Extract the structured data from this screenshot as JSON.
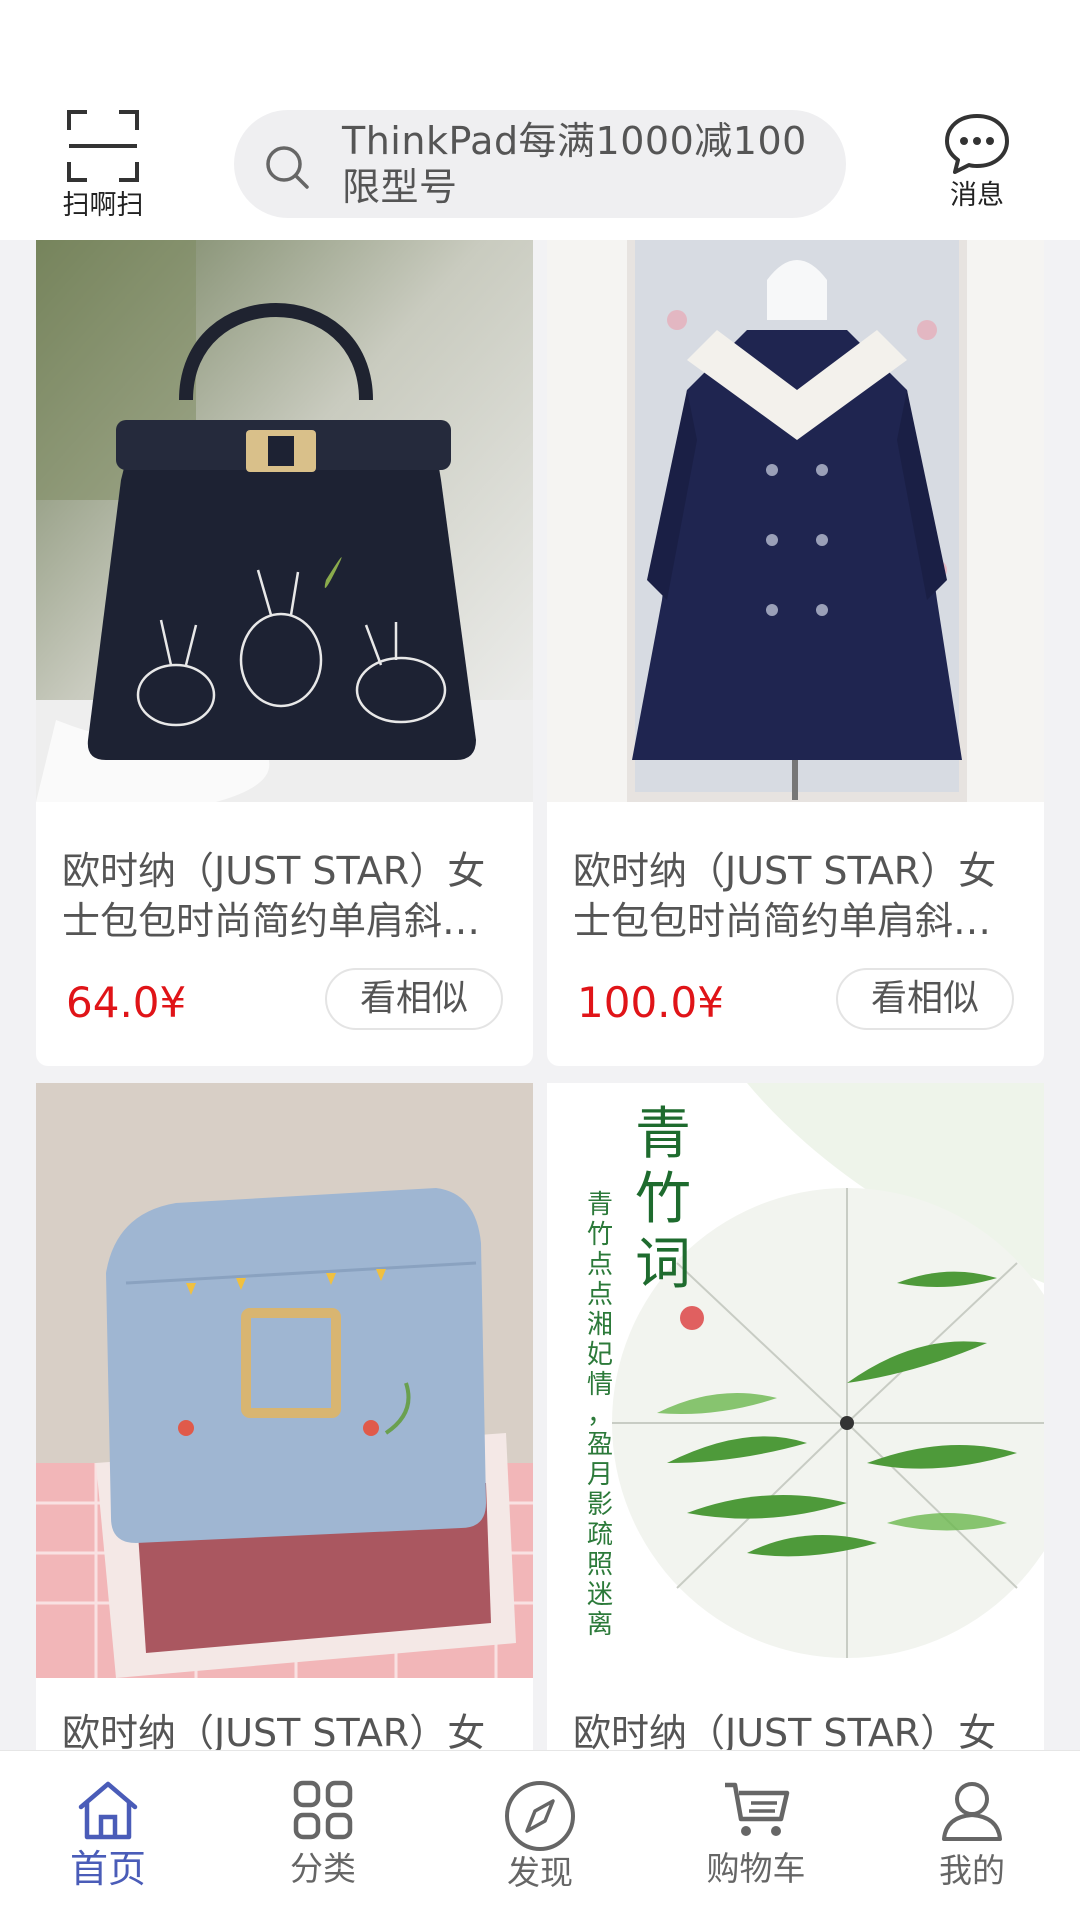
{
  "header": {
    "scan_label": "扫啊扫",
    "search_placeholder_line1": "ThinkPad每满1000减100",
    "search_placeholder_line2": "限型号",
    "message_label": "消息"
  },
  "products": [
    {
      "image": "navy-handbag-rabbit-embroidery",
      "title": "欧时纳（JUST STAR）女士包包时尚简约单肩斜挎包",
      "price": "64.0¥",
      "similar_label": "看相似"
    },
    {
      "image": "navy-double-breasted-coat-white-collar",
      "title": "欧时纳（JUST STAR）女士包包时尚简约单肩斜挎包",
      "price": "100.0¥",
      "similar_label": "看相似"
    },
    {
      "image": "light-blue-embroidered-crossbody-bag",
      "title": "欧时纳（JUST STAR）女",
      "price": "",
      "similar_label": ""
    },
    {
      "image": "bamboo-print-umbrella",
      "title": "欧时纳（JUST STAR）女",
      "price": "",
      "similar_label": ""
    }
  ],
  "umbrella_text": {
    "big": "青竹词",
    "poem": "青竹点点湘妃情，盈月影疏照迷离"
  },
  "tabbar": {
    "items": [
      {
        "label": "首页",
        "icon": "home-icon",
        "active": true
      },
      {
        "label": "分类",
        "icon": "category-grid-icon",
        "active": false
      },
      {
        "label": "发现",
        "icon": "compass-icon",
        "active": false
      },
      {
        "label": "购物车",
        "icon": "cart-icon",
        "active": false
      },
      {
        "label": "我的",
        "icon": "user-icon",
        "active": false
      }
    ]
  },
  "colors": {
    "price": "#e01418",
    "active_tab": "#4a5cb8",
    "background": "#f2f2f4"
  }
}
